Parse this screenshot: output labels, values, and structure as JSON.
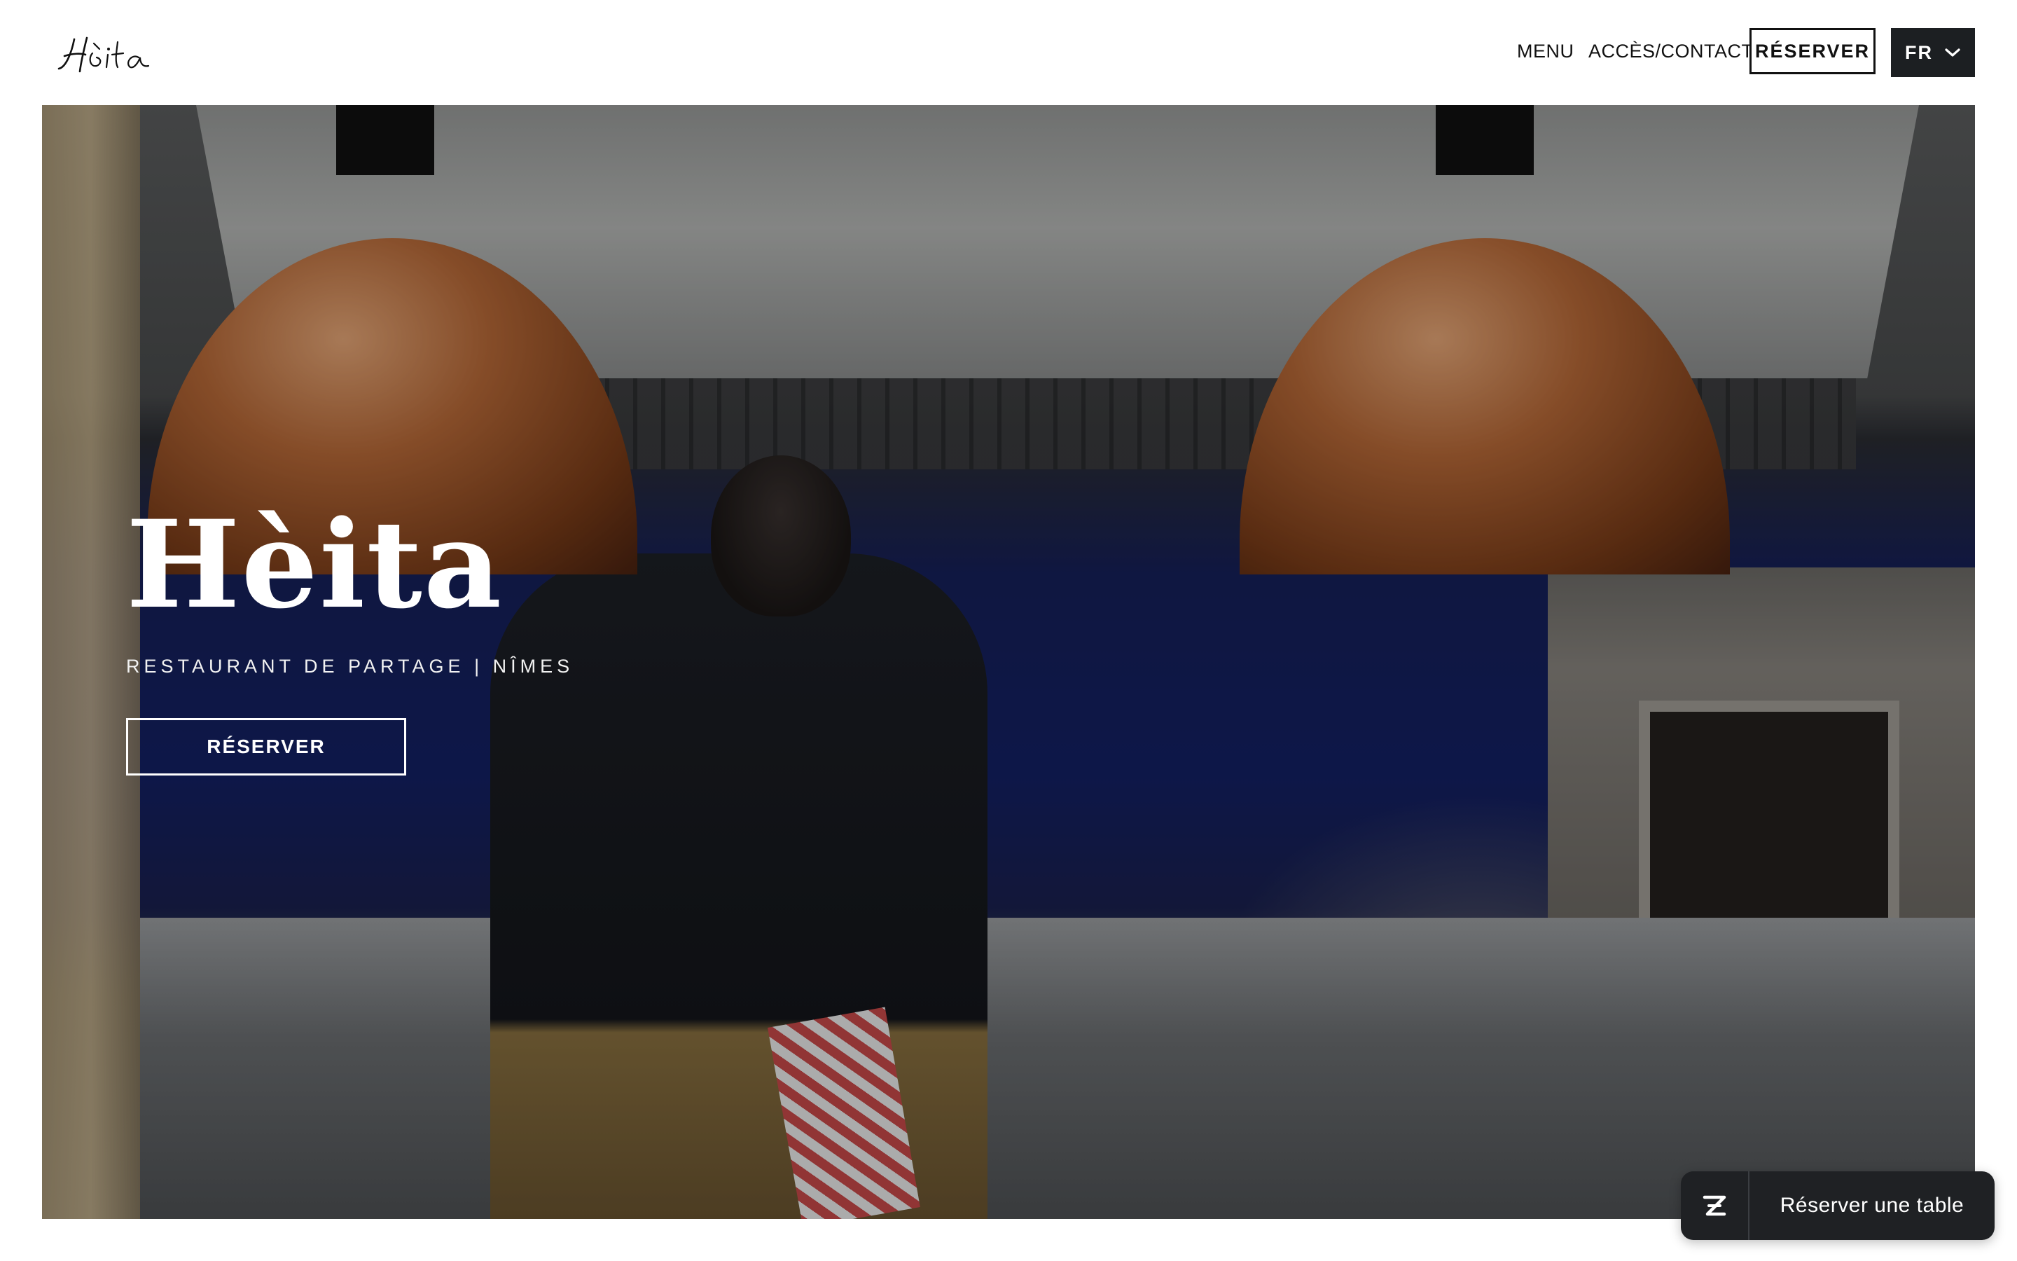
{
  "header": {
    "logo_text": "Hèita",
    "nav": {
      "menu_label": "MENU",
      "contact_label": "ACCÈS/CONTACT"
    },
    "reserve_label": "RÉSERVER",
    "language": {
      "selected": "FR"
    }
  },
  "hero": {
    "title": "Hèita",
    "subtitle": "RESTAURANT DE PARTAGE | NÎMES",
    "cta_label": "RÉSERVER",
    "image_alt_icon": "kitchen-photo"
  },
  "widget": {
    "icon": "zenchef-z-icon",
    "label": "Réserver une table"
  },
  "colors": {
    "header_bg": "#ffffff",
    "text_dark": "#111111",
    "lang_bg": "#1c1f22",
    "widget_bg": "#1f2124",
    "hero_text": "#ffffff"
  }
}
